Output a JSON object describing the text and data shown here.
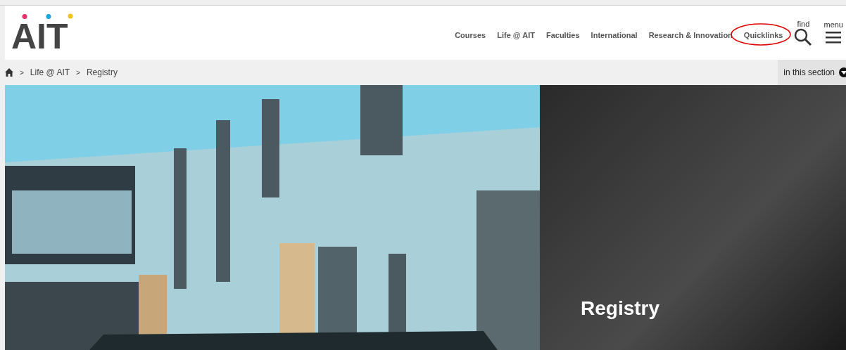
{
  "logo": {
    "text": "AIT"
  },
  "nav": [
    {
      "label": "Courses",
      "circled": false
    },
    {
      "label": "Life @ AIT",
      "circled": false
    },
    {
      "label": "Faculties",
      "circled": false
    },
    {
      "label": "International",
      "circled": false
    },
    {
      "label": "Research & Innovation",
      "circled": false
    },
    {
      "label": "Quicklinks",
      "circled": true
    }
  ],
  "find": {
    "label": "find"
  },
  "menu": {
    "label": "menu"
  },
  "breadcrumb": [
    "Life @ AIT",
    "Registry"
  ],
  "breadcrumb_separator": ">",
  "section_toggle": {
    "label": "in this section"
  },
  "hero": {
    "title": "Registry"
  }
}
